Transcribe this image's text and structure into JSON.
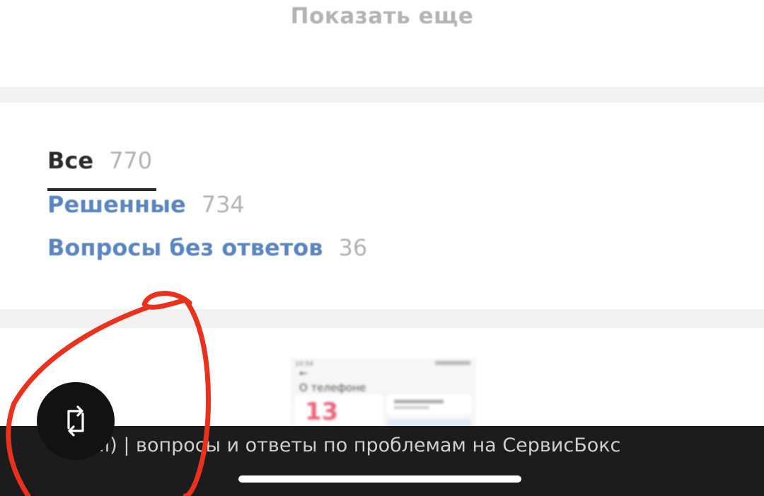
{
  "show_more": {
    "label": "Показать еще"
  },
  "filters": [
    {
      "label": "Все",
      "count": "770",
      "active": true
    },
    {
      "label": "Решенные",
      "count": "734",
      "active": false
    },
    {
      "label": "Вопросы без ответов",
      "count": "36",
      "active": false
    }
  ],
  "thumbnail": {
    "screen_title": "О телефоне",
    "badge": "13"
  },
  "bottom_bar": {
    "title": "...i) | вопросы и ответы по проблемам на СервисБокс"
  },
  "icons": {
    "rotate": "rotate-icon",
    "back": "back-arrow-icon"
  },
  "colors": {
    "link": "#5b86bd",
    "active": "#2b2b2b",
    "muted": "#b3b3b3",
    "bar": "#1c1c1c",
    "annotation": "#e8321e"
  }
}
